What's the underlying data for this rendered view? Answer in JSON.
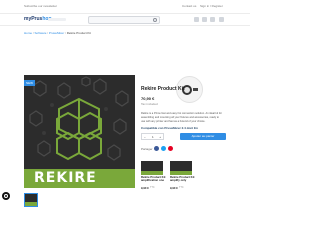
{
  "topbar": {
    "subtitle": "Subscribe our newsletter",
    "links": [
      "Contact us",
      "Sign in / Register"
    ]
  },
  "header": {
    "logo_part1": "myPrus",
    "logo_part2": "hop",
    "search_icon": "search-icon"
  },
  "breadcrumb": {
    "items": [
      "Home",
      "Software",
      "PrusaSlicer"
    ],
    "current": "Rekire Product Kit"
  },
  "product": {
    "badge": "NEW",
    "image_text": "REKIRE",
    "title": "Rekire Product Kit",
    "price": "70,90 €",
    "tax": "Tax included",
    "description": "Rekire is a Prime fast and easy hot connection solution. An ideal kit for assembling and mounting all your fixtures and accessories, ready to use with any printer and fast as a hotend of your choice.",
    "compatibility": "Compatible con PrusaSlicer 2.4 dont En",
    "quantity": "1",
    "qty_minus": "−",
    "qty_plus": "+",
    "add_to_cart": "Ajouter au panier",
    "share_label": "Partager"
  },
  "related": [
    {
      "title": "Rekire Product Kit amplification one",
      "price": "9,90 €",
      "tax": "TTC"
    },
    {
      "title": "Rekire Product Kit amplify only",
      "price": "9,90 €",
      "tax": "TTC"
    }
  ],
  "colors": {
    "accent": "#2f8de4",
    "brand_green": "#7aa83a",
    "image_bg": "#2c2c2c"
  }
}
